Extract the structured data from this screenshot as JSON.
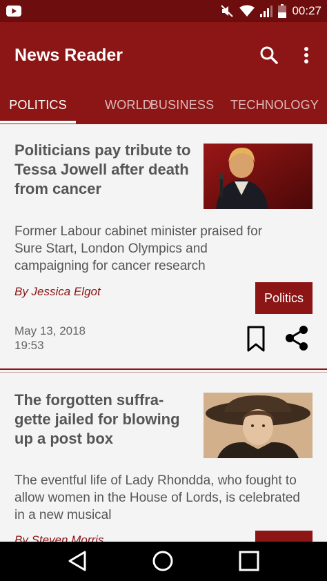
{
  "status_bar": {
    "time": "00:27",
    "icons": [
      "youtube-icon",
      "mute-icon",
      "wifi-icon",
      "signal-icon",
      "battery-icon"
    ]
  },
  "app_bar": {
    "title": "News Reader",
    "actions": [
      "search-icon",
      "more-vert-icon"
    ]
  },
  "tabs": [
    {
      "label": "POLITICS",
      "active": true
    },
    {
      "label": "WORLD",
      "active": false
    },
    {
      "label": "BUSINESS",
      "active": false
    },
    {
      "label": "TECHNOLOGY",
      "active": false
    }
  ],
  "articles": [
    {
      "headline": "Politicians pay tribute to Tessa Jowell after death from cancer",
      "summary": "Former Labour cabinet minister praised for Sure Start, London Olympics and campaigning for cancer research",
      "byline": "By Jessica Elgot",
      "category": "Politics",
      "date": "May 13, 2018",
      "time": "19:53"
    },
    {
      "headline": "The forgotten suffra-gette jailed for blowing up a post box",
      "summary": "The eventful life of Lady Rhondda, who fought to allow women in the House of Lords, is celebrated in a new musical",
      "byline": "By Steven Morris"
    }
  ],
  "colors": {
    "status_bar": "#6e0d0d",
    "primary": "#8c1515",
    "background": "#f4f4f4",
    "text": "#555555"
  },
  "nav_bar": {
    "icons": [
      "back-icon",
      "home-icon",
      "recents-icon"
    ]
  }
}
